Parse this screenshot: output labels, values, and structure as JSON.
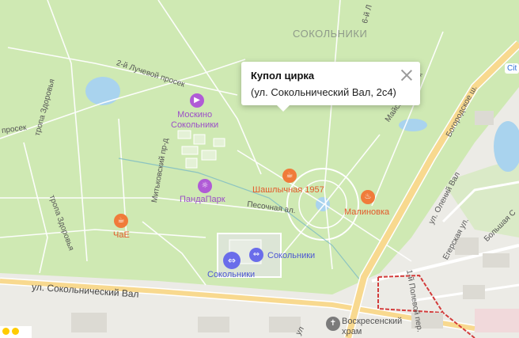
{
  "map": {
    "district": "СОКОЛЬНИКИ",
    "colors": {
      "park": "#cfe9b3",
      "path": "#ffffff",
      "water": "#a9d3ee",
      "main_road": "#f8d98f",
      "city": "#ecebe6"
    },
    "streets": {
      "luchevoy": "2-й Лучевой просек",
      "prosek": "просек",
      "tropa1": "тропа Здоровья",
      "tropa2": "тропа Здоровья",
      "mitkovsky": "Митьковский пр-д",
      "pesochnaya": "Песочная ал.",
      "sokolnichesky_val": "ул. Сокольнический Вал",
      "bogorodskoe": "Богородское ш.",
      "olenij": "ул. Олений Вал",
      "egersky": "Егерская ул.",
      "polevoy": "1-й Полевой пер.",
      "bolshaya": "Большая С",
      "six_luch": "6-й Л",
      "mayskiy": "Майский просек",
      "ul_bottom": "ул"
    },
    "pois": {
      "moskino": "Москино\nСокольники",
      "pandapark": "ПандаПарк",
      "shashlychnaya": "Шашлычная 1957",
      "malinovka": "Малиновка",
      "chae": "ЧаЕ",
      "sokolniki_sport": "Сокольники",
      "sokolniki_stadium": "Сокольники",
      "voskresensky": "Воскресенский\nхрам"
    },
    "popup": {
      "title": "Купол цирка",
      "address": "(ул. Сокольнический Вал, 2с4)"
    },
    "badge": "Cit",
    "icons": {
      "cinema": "cinema-icon",
      "park": "amusement-park-icon",
      "cafe": "cafe-icon",
      "restaurant": "restaurant-icon",
      "sport": "sport-icon",
      "church": "church-icon"
    }
  }
}
